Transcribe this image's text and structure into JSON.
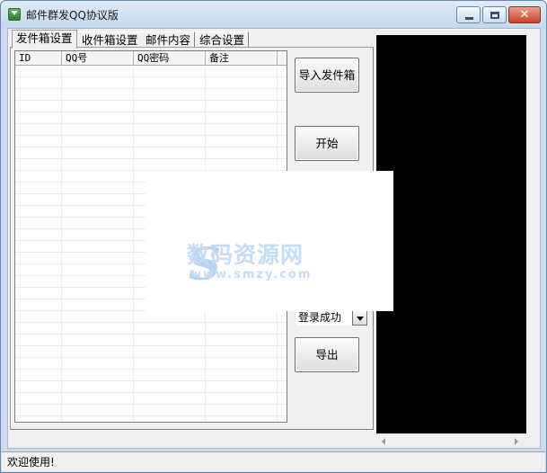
{
  "window": {
    "title": "邮件群发QQ协议版"
  },
  "titlebar": {
    "close_glyph": "✕"
  },
  "tabs": [
    {
      "label": "发件箱设置"
    },
    {
      "label": "收件箱设置"
    },
    {
      "label": "邮件内容"
    },
    {
      "label": "综合设置"
    }
  ],
  "table": {
    "columns": [
      "ID",
      "QQ号",
      "QQ密码",
      "备注"
    ],
    "rows": []
  },
  "buttons": {
    "import_label": "导入发件箱",
    "start_label": "开始",
    "export_label": "导出"
  },
  "login_status": {
    "selected": "登录成功"
  },
  "watermark": {
    "logo_glyph": "S",
    "text": "数码资源网",
    "url": "www.smzy.com"
  },
  "statusbar": {
    "text": "欢迎使用!"
  },
  "colors": {
    "console_bg": "#000000",
    "window_frame": "#c9dcf0",
    "close_button": "#c8432b"
  }
}
